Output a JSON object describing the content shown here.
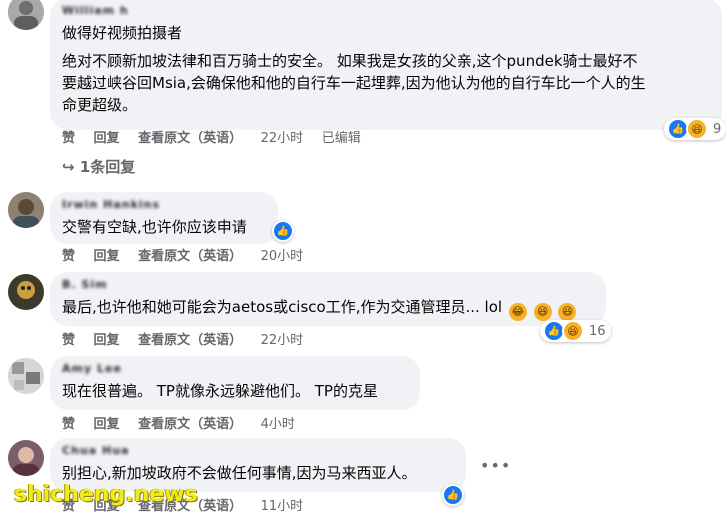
{
  "comments": [
    {
      "author": "William h",
      "lines": [
        "做得好视频拍摄者",
        "绝对不顾新加坡法律和百万骑士的安全。 如果我是女孩的父亲,这个pundek骑士最好不",
        "要越过峡谷回Msia,会确保他和他的自行车一起埋葬,因为他认为他的自行车比一个人的生",
        "命更超级。"
      ],
      "like": "赞",
      "reply": "回复",
      "translate": "查看原文（英语）",
      "time": "22小时",
      "edited": "已编辑",
      "reaction_count": "9",
      "replies_link": "↪ 1条回复"
    },
    {
      "author": "Irwin Hankins",
      "lines": [
        "交警有空缺,也许你应该申请"
      ],
      "like": "赞",
      "reply": "回复",
      "translate": "查看原文（英语）",
      "time": "20小时"
    },
    {
      "author": "B. Sim",
      "lines": [
        "最后,也许他和她可能会为aetos或cisco工作,作为交通管理员... lol"
      ],
      "like": "赞",
      "reply": "回复",
      "translate": "查看原文（英语）",
      "time": "22小时",
      "reaction_count": "16"
    },
    {
      "author": "Amy  Lee",
      "lines": [
        "现在很普遍。 TP就像永远躲避他们。 TP的克星"
      ],
      "like": "赞",
      "reply": "回复",
      "translate": "查看原文（英语）",
      "time": "4小时"
    },
    {
      "author": "Chua Hua",
      "lines": [
        "别担心,新加坡政府不会做任何事情,因为马来西亚人。"
      ],
      "like": "赞",
      "reply": "回复",
      "translate": "查看原文（英语）",
      "time": "11小时"
    }
  ],
  "watermark": "shicheng.news",
  "more_icon": "more-horizontal-icon",
  "colors": {
    "bubble": "#f0f2f5",
    "muted": "#65676b",
    "like_blue": "#1877f2",
    "haha_yellow": "#f7b125"
  }
}
